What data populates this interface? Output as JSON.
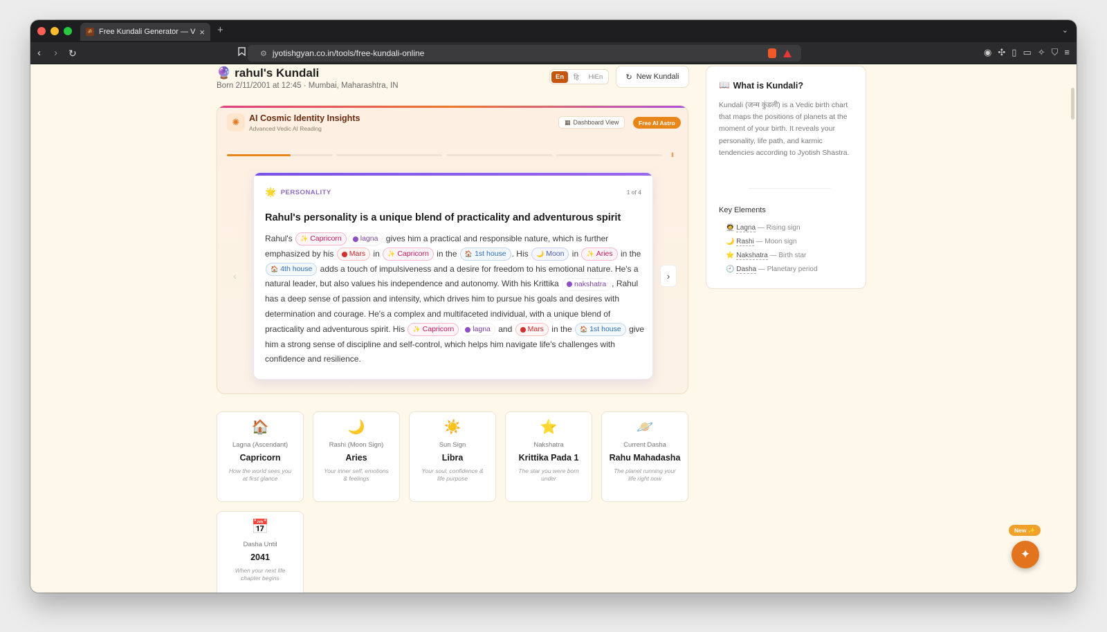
{
  "browser": {
    "tab_title": "Free Kundali Generator — Vedic",
    "new_tab": "+",
    "tab_close": "×",
    "url": "jyotishgyan.co.in/tools/free-kundali-online"
  },
  "header": {
    "title": "rahul's Kundali",
    "born": "Born 2/11/2001 at 12:45 · Mumbai, Maharashtra, IN",
    "languages": [
      "En",
      "हि",
      "HiEn"
    ],
    "active_language": "En",
    "new_kundali": "New Kundali"
  },
  "insights": {
    "title": "AI Cosmic Identity Insights",
    "subtitle": "Advanced Vedic AI Reading",
    "dashboard_view": "Dashboard View",
    "free_ai_astro": "Free AI Astro",
    "pause": "II",
    "progress": [
      0.6,
      0,
      0,
      0
    ],
    "card": {
      "category": "PERSONALITY",
      "page": "1 of 4",
      "title": "Rahul's personality is a unique blend of practicality and adventurous spirit",
      "body": [
        {
          "t": "Rahul's "
        },
        {
          "chip": "sign",
          "t": "Capricorn"
        },
        {
          "chip": "lagna",
          "t": "lagna"
        },
        {
          "t": " gives him a practical and responsible nature, which is further emphasized by his "
        },
        {
          "chip": "planet",
          "t": "Mars"
        },
        {
          "t": " in "
        },
        {
          "chip": "sign",
          "t": "Capricorn"
        },
        {
          "t": " in the "
        },
        {
          "chip": "house",
          "t": "1st house"
        },
        {
          "t": ". His "
        },
        {
          "chip": "moon",
          "t": "Moon"
        },
        {
          "t": " in "
        },
        {
          "chip": "sign",
          "t": "Aries"
        },
        {
          "t": " in the "
        },
        {
          "chip": "house",
          "t": "4th house"
        },
        {
          "t": " adds a touch of impulsiveness and a desire for freedom to his emotional nature. He's a natural leader, but also values his independence and autonomy. With his Krittika "
        },
        {
          "chip": "lagna",
          "t": "nakshatra"
        },
        {
          "t": ", Rahul has a deep sense of passion and intensity, which drives him to pursue his goals and desires with determination and courage. He's a complex and multifaceted individual, with a unique blend of practicality and adventurous spirit. His "
        },
        {
          "chip": "sign",
          "t": "Capricorn"
        },
        {
          "chip": "lagna",
          "t": "lagna"
        },
        {
          "t": " and "
        },
        {
          "chip": "planet",
          "t": "Mars"
        },
        {
          "t": " in the "
        },
        {
          "chip": "house",
          "t": "1st house"
        },
        {
          "t": " give him a strong sense of discipline and self-control, which helps him navigate life's challenges with confidence and resilience."
        }
      ]
    }
  },
  "tiles": [
    {
      "icon": "🏠",
      "label": "Lagna (Ascendant)",
      "value": "Capricorn",
      "desc": "How the world sees you at first glance"
    },
    {
      "icon": "🌙",
      "label": "Rashi (Moon Sign)",
      "value": "Aries",
      "desc": "Your inner self, emotions & feelings"
    },
    {
      "icon": "☀️",
      "label": "Sun Sign",
      "value": "Libra",
      "desc": "Your soul, confidence & life purpose"
    },
    {
      "icon": "⭐",
      "label": "Nakshatra",
      "value": "Krittika Pada 1",
      "desc": "The star you were born under"
    },
    {
      "icon": "🪐",
      "label": "Current Dasha",
      "value": "Rahu Mahadasha",
      "desc": "The planet running your life right now"
    },
    {
      "icon": "📅",
      "label": "Dasha Until",
      "value": "2041",
      "desc": "When your next life chapter begins"
    }
  ],
  "sidebar": {
    "title": "What is Kundali?",
    "text": "Kundali (जन्म कुंडली) is a Vedic birth chart that maps the positions of planets at the moment of your birth. It reveals your personality, life path, and karmic tendencies according to Jyotish Shastra.",
    "key_elements_title": "Key Elements",
    "elements": [
      {
        "icon": "🧑‍🚀",
        "term": "Lagna",
        "desc": "— Rising sign"
      },
      {
        "icon": "🌙",
        "term": "Rashi",
        "desc": "— Moon sign"
      },
      {
        "icon": "⭐",
        "term": "Nakshatra",
        "desc": "— Birth star"
      },
      {
        "icon": "🕘",
        "term": "Dasha",
        "desc": "— Planetary period"
      }
    ]
  },
  "fab": {
    "badge": "New ✨"
  },
  "colors": {
    "accent": "#e3741e",
    "active_lang": "#c5560e",
    "card_accent": "#7a52e8",
    "page_bg": "#fdf8ea"
  }
}
